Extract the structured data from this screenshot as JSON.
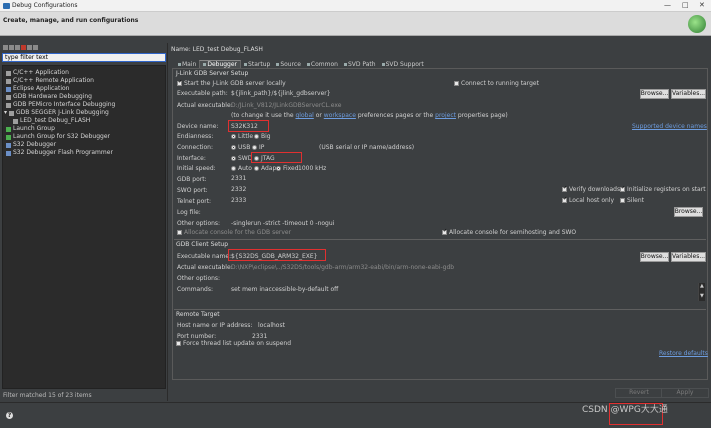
{
  "window": {
    "title": "Debug Configurations"
  },
  "header": {
    "subtitle": "Create, manage, and run configurations"
  },
  "left": {
    "filter_placeholder": "type filter text",
    "tree": [
      {
        "label": "C/C++ Application",
        "indent": 0
      },
      {
        "label": "C/C++ Remote Application",
        "indent": 0
      },
      {
        "label": "Eclipse Application",
        "indent": 0
      },
      {
        "label": "GDB Hardware Debugging",
        "indent": 0
      },
      {
        "label": "GDB PEMicro Interface Debugging",
        "indent": 0
      },
      {
        "label": "GDB SEGGER J-Link Debugging",
        "indent": 0
      },
      {
        "label": "LED_test Debug_FLASH",
        "indent": 1
      },
      {
        "label": "Launch Group",
        "indent": 0
      },
      {
        "label": "Launch Group for S32 Debugger",
        "indent": 0
      },
      {
        "label": "S32 Debugger",
        "indent": 0
      },
      {
        "label": "S32 Debugger Flash Programmer",
        "indent": 0
      }
    ],
    "status": "Filter matched 15 of 23 items"
  },
  "config": {
    "name_label": "Name:",
    "name_value": "LED_test Debug_FLASH",
    "tabs": [
      "Main",
      "Debugger",
      "Startup",
      "Source",
      "Common",
      "SVD Path",
      "SVD Support"
    ],
    "active_tab": "Debugger"
  },
  "jlink": {
    "legend": "J-Link GDB Server Setup",
    "start_server": "Start the J-Link GDB server locally",
    "connect_running": "Connect to running target",
    "exec_path_label": "Executable path:",
    "exec_path_value": "${jlink_path}/${jlink_gdbserver}",
    "actual_exec_label": "Actual executable:",
    "actual_exec_value": "D:/JLink_V812/JLinkGDBServerCL.exe",
    "hint_pre": "(to change it use the",
    "hint_global": "global",
    "hint_or": "or",
    "hint_workspace": "workspace",
    "hint_mid": "preferences pages or the",
    "hint_project": "project",
    "hint_post": "properties page)",
    "device_label": "Device name:",
    "device_value": "S32K312",
    "supported_link": "Supported device names",
    "endianness_label": "Endianness:",
    "little": "Little",
    "big": "Big",
    "connection_label": "Connection:",
    "usb": "USB",
    "ip": "IP",
    "usb_hint": "(USB serial or IP name/address)",
    "interface_label": "Interface:",
    "swd": "SWD",
    "jtag": "JTAG",
    "speed_label": "Initial speed:",
    "auto": "Auto",
    "adaptive": "Adap",
    "fixed": "Fixed",
    "speed_value": "1000 kHz",
    "gdb_port_label": "GDB port:",
    "gdb_port": "2331",
    "swo_port_label": "SWO port:",
    "swo_port": "2332",
    "verify": "Verify downloads",
    "init_regs": "Initialize registers on start",
    "telnet_label": "Telnet port:",
    "telnet_port": "2333",
    "local_host": "Local host only",
    "silent": "Silent",
    "log_label": "Log file:",
    "browse": "Browse...",
    "variables": "Variables...",
    "other_label": "Other options:",
    "other_value": "-singlerun -strict -timeout 0 -nogui",
    "allocate_remote": "Allocate console for the GDB server",
    "allocate_semi": "Allocate console for semihosting and SWO"
  },
  "gdb": {
    "legend": "GDB Client Setup",
    "exec_label": "Executable name:",
    "exec_value": "${S32DS_GDB_ARM32_EXE}",
    "actual_label": "Actual executable:",
    "actual_value": "D:\\NXP\\eclipse\\../S32DS/tools/gdb-arm/arm32-eabi/bin/arm-none-eabi-gdb",
    "other_label": "Other options:",
    "commands_label": "Commands:",
    "commands_value": "set mem inaccessible-by-default off"
  },
  "remote": {
    "legend": "Remote Target",
    "host_label": "Host name or IP address:",
    "host_value": "localhost",
    "port_label": "Port number:",
    "port_value": "2331"
  },
  "force_thread": "Force thread list update on suspend",
  "restore": "Restore defaults",
  "revert": "Revert",
  "apply": "Apply",
  "footer": {
    "help": "?",
    "watermark": "CSDN @WPG大大通"
  }
}
